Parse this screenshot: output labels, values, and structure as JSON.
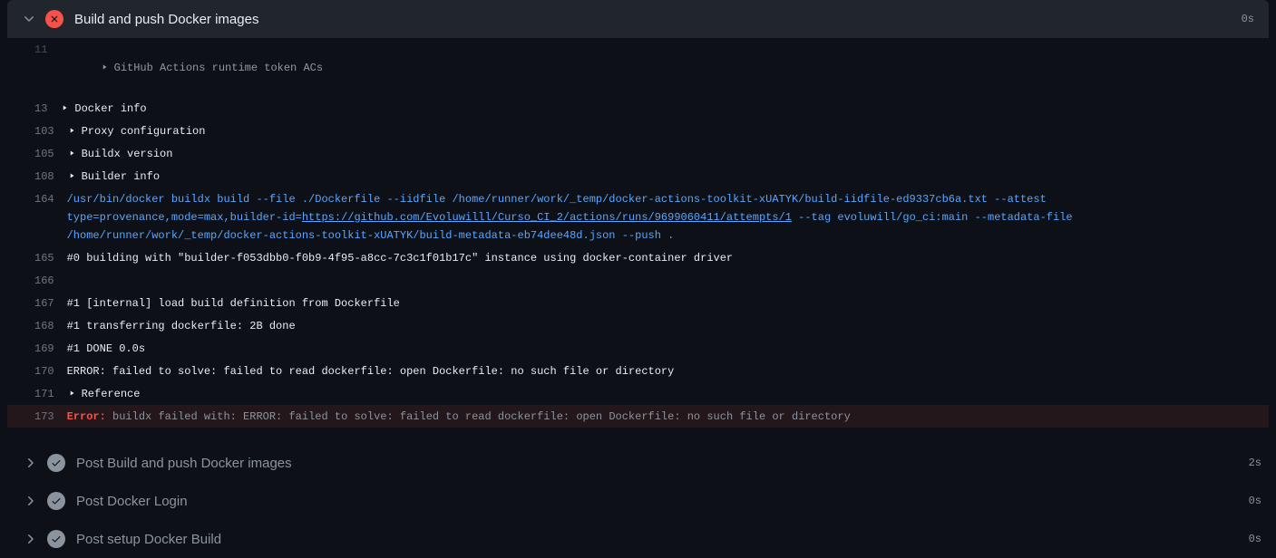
{
  "main_step": {
    "title": "Build and push Docker images",
    "duration": "0s",
    "status": "error"
  },
  "log": {
    "truncated_title": "GitHub Actions runtime token ACs",
    "truncated_ln": "11",
    "folds": [
      {
        "ln": "13",
        "label": "Docker info"
      },
      {
        "ln": "103",
        "label": "Proxy configuration"
      },
      {
        "ln": "105",
        "label": "Buildx version"
      },
      {
        "ln": "108",
        "label": "Builder info"
      }
    ],
    "cmd_ln": "164",
    "cmd_pre": "/usr/bin/docker buildx build --file ./Dockerfile --iidfile /home/runner/work/_temp/docker-actions-toolkit-xUATYK/build-iidfile-ed9337cb6a.txt --attest type=provenance,mode=max,builder-id=",
    "cmd_link": "https://github.com/Evoluwilll/Curso_CI_2/actions/runs/9699060411/attempts/1",
    "cmd_post": " --tag evoluwill/go_ci:main --metadata-file /home/runner/work/_temp/docker-actions-toolkit-xUATYK/build-metadata-eb74dee48d.json --push .",
    "lines": [
      {
        "ln": "165",
        "text": "#0 building with \"builder-f053dbb0-f0b9-4f95-a8cc-7c3c1f01b17c\" instance using docker-container driver"
      },
      {
        "ln": "166",
        "text": ""
      },
      {
        "ln": "167",
        "text": "#1 [internal] load build definition from Dockerfile"
      },
      {
        "ln": "168",
        "text": "#1 transferring dockerfile: 2B done"
      },
      {
        "ln": "169",
        "text": "#1 DONE 0.0s"
      },
      {
        "ln": "170",
        "text": "ERROR: failed to solve: failed to read dockerfile: open Dockerfile: no such file or directory"
      }
    ],
    "ref_ln": "171",
    "ref_label": "Reference",
    "err_ln": "173",
    "err_prefix": "Error: ",
    "err_text": "buildx failed with: ERROR: failed to solve: failed to read dockerfile: open Dockerfile: no such file or directory"
  },
  "post_steps": [
    {
      "title": "Post Build and push Docker images",
      "duration": "2s"
    },
    {
      "title": "Post Docker Login",
      "duration": "0s"
    },
    {
      "title": "Post setup Docker Build",
      "duration": "0s"
    }
  ]
}
